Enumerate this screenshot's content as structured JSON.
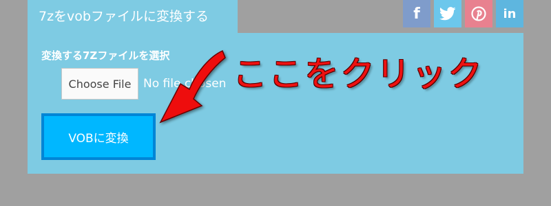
{
  "tab": {
    "title": "7zをvobファイルに変換する"
  },
  "social": {
    "facebook_icon": "f",
    "twitter_icon": "twitter-bird",
    "pinterest_icon": "pinterest-p",
    "linkedin_icon": "in"
  },
  "form": {
    "section_label": "変換する7Zファイルを選択",
    "file_button_label": "Choose File",
    "file_status": "No file chosen",
    "convert_button_label": "VOBに変換"
  },
  "annotation": {
    "text": "ここをクリック",
    "color": "#ee1111"
  },
  "colors": {
    "background": "#a0a0a0",
    "panel": "#7ecbe3",
    "convert_button": "#00b7ff",
    "convert_border": "#0085d6"
  }
}
